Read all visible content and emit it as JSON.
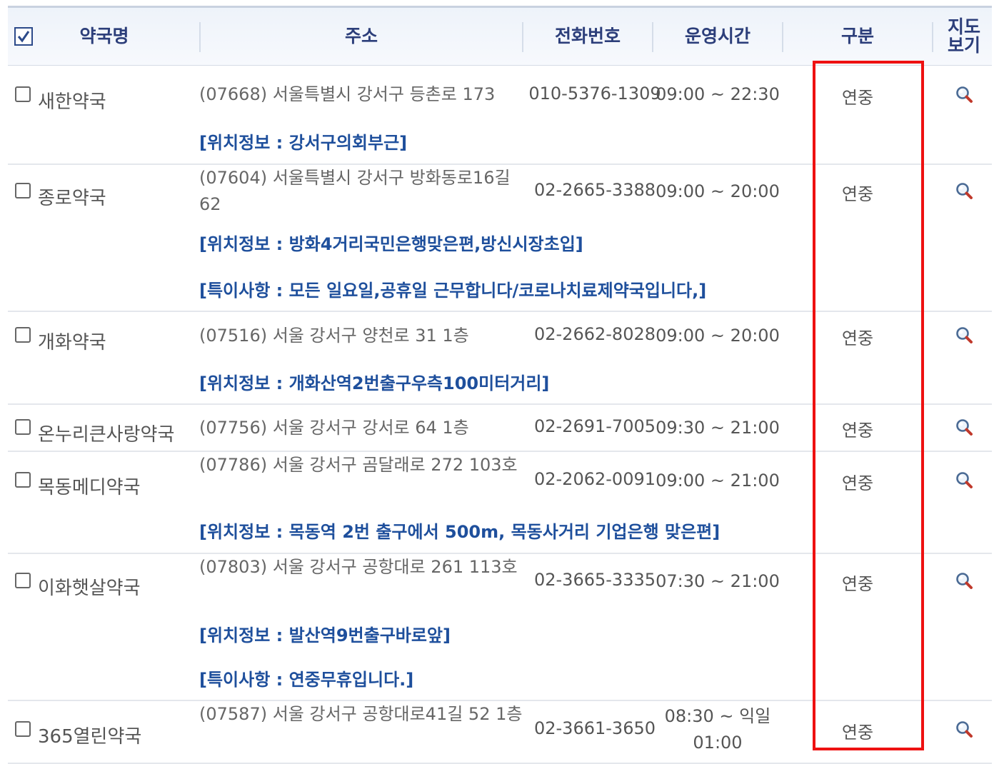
{
  "header": {
    "columns": [
      "약국명",
      "주소",
      "전화번호",
      "운영시간",
      "구분",
      "지도\n보기"
    ],
    "select_all_checked": true
  },
  "rows": [
    {
      "name": "새한약국",
      "address": "(07668) 서울특별시 강서구 등촌로 173",
      "phone": "010-5376-1309",
      "hours": "09:00 ~ 22:30",
      "type": "연중",
      "info": [
        "[위치정보 : 강서구의회부근]"
      ]
    },
    {
      "name": "종로약국",
      "address": "(07604) 서울특별시 강서구 방화동로16길 62",
      "phone": "02-2665-3388",
      "hours": "09:00 ~ 20:00",
      "type": "연중",
      "info": [
        "[위치정보 : 방화4거리국민은행맞은편,방신시장초입]",
        "[특이사항 : 모든 일요일,공휴일 근무합니다/코로나치료제약국입니다,]"
      ]
    },
    {
      "name": "개화약국",
      "address": "(07516) 서울 강서구 양천로 31 1층",
      "phone": "02-2662-8028",
      "hours": "09:00 ~ 20:00",
      "type": "연중",
      "info": [
        "[위치정보 : 개화산역2번출구우측100미터거리]"
      ]
    },
    {
      "name": "온누리큰사랑약국",
      "address": "(07756) 서울 강서구 강서로 64 1층",
      "phone": "02-2691-7005",
      "hours": "09:30 ~ 21:00",
      "type": "연중",
      "info": []
    },
    {
      "name": "목동메디약국",
      "address": "(07786) 서울 강서구 곰달래로 272 103호",
      "phone": "02-2062-0091",
      "hours": "09:00 ~ 21:00",
      "type": "연중",
      "info": [
        "[위치정보 : 목동역 2번 출구에서 500m, 목동사거리 기업은행 맞은편]"
      ]
    },
    {
      "name": "이화햇살약국",
      "address": "(07803) 서울 강서구 공항대로 261 113호",
      "phone": "02-3665-3335",
      "hours": "07:30 ~ 21:00",
      "type": "연중",
      "info": [
        "[위치정보 : 발산역9번출구바로앞]",
        "[특이사항 : 연중무휴입니다.]"
      ]
    },
    {
      "name": "365열린약국",
      "address": "(07587) 서울 강서구 공항대로41길 52 1층",
      "phone": "02-3661-3650",
      "hours": "08:30 ~ 익일 01:00",
      "type": "연중",
      "info": []
    }
  ],
  "highlight_color": "#ee1111",
  "icons": {
    "map_view": "magnifier-icon",
    "select": "checkbox-icon"
  }
}
